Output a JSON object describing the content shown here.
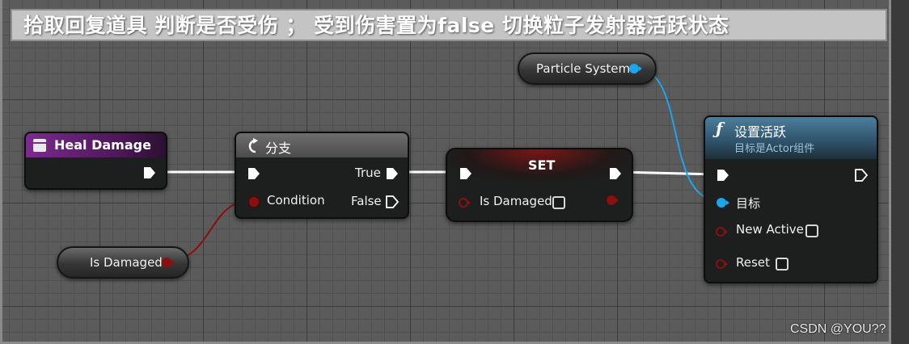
{
  "comment": {
    "text": "拾取回复道具 判断是否受伤 ； 受到伤害置为false 切换粒子发射器活跃状态"
  },
  "nodes": {
    "heal_event": {
      "title": "Heal Damage",
      "icon": "event-icon"
    },
    "branch": {
      "title": "分支",
      "icon": "branch-icon",
      "true_label": "True",
      "false_label": "False",
      "condition_label": "Condition"
    },
    "set": {
      "title": "SET",
      "var_label": "Is Damaged"
    },
    "get_var": {
      "label": "Is Damaged"
    },
    "particle_var": {
      "label": "Particle System"
    },
    "set_active": {
      "title": "设置活跃",
      "subtitle": "目标是Actor组件",
      "target_label": "目标",
      "new_active_label": "New Active",
      "reset_label": "Reset",
      "icon": "function-icon"
    }
  },
  "colors": {
    "bool_pin": "#8a0f0f",
    "object_pin": "#1ba5ea",
    "exec": "#ffffff",
    "event_header": "#6a1f7a",
    "function_header": "#3b6a8a"
  },
  "watermark": "CSDN @YOU??"
}
